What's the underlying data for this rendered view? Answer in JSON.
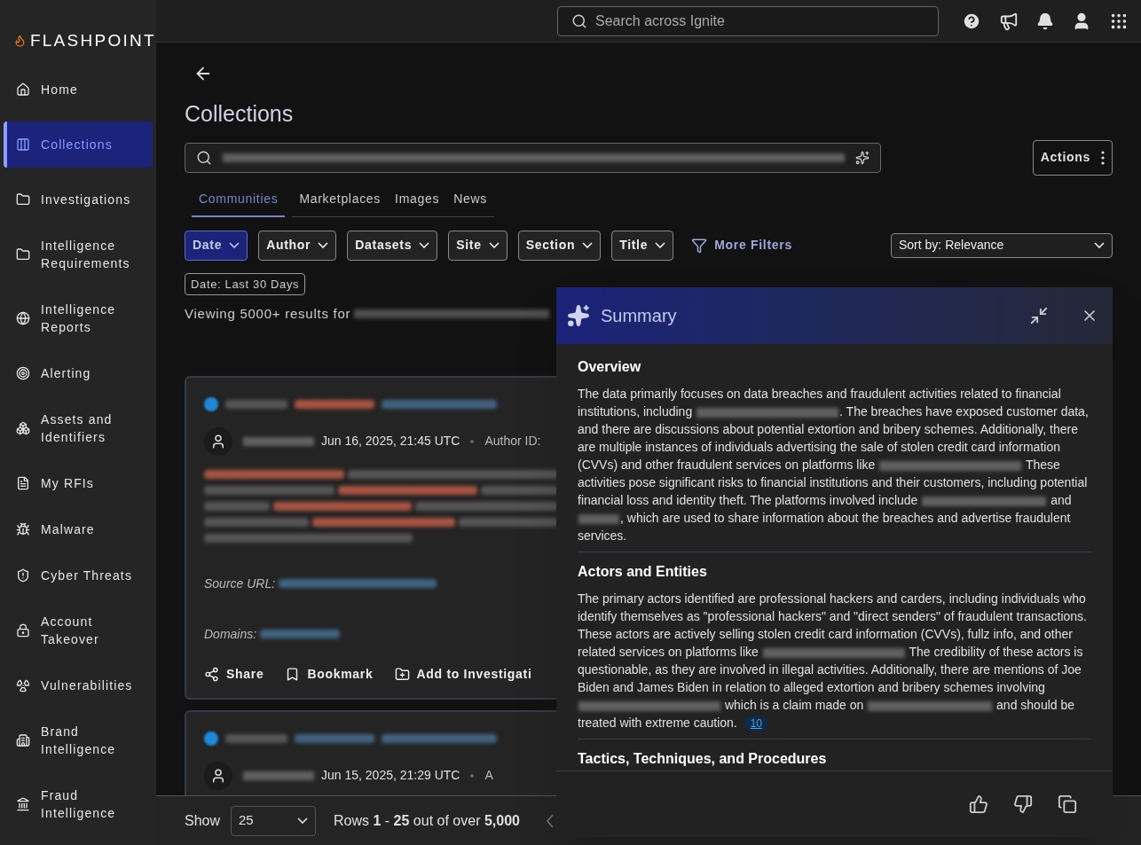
{
  "brand": {
    "name": "FLASHPOINT"
  },
  "sidebar": {
    "items": [
      {
        "label": "Home",
        "selected": false
      },
      {
        "label": "Collections",
        "selected": true
      },
      {
        "label": "Investigations",
        "selected": false
      },
      {
        "label": "Intelligence Requirements",
        "selected": false
      },
      {
        "label": "Intelligence Reports",
        "selected": false
      },
      {
        "label": "Alerting",
        "selected": false
      },
      {
        "label": "Assets and Identifiers",
        "selected": false
      },
      {
        "label": "My RFIs",
        "selected": false
      },
      {
        "label": "Malware",
        "selected": false
      },
      {
        "label": "Cyber Threats",
        "selected": false
      },
      {
        "label": "Account Takeover",
        "selected": false
      },
      {
        "label": "Vulnerabilities",
        "selected": false
      },
      {
        "label": "Brand Intelligence",
        "selected": false
      },
      {
        "label": "Fraud Intelligence",
        "selected": false
      }
    ]
  },
  "top_bar": {
    "search": {
      "placeholder": "Search across Ignite"
    }
  },
  "page": {
    "title": "Collections",
    "actions_button": "Actions",
    "tabs": [
      {
        "label": "Communities",
        "selected": true
      },
      {
        "label": "Marketplaces",
        "selected": false
      },
      {
        "label": "Images",
        "selected": false
      },
      {
        "label": "News",
        "selected": false
      }
    ],
    "filters": [
      {
        "label": "Date",
        "selected": true
      },
      {
        "label": "Author",
        "selected": false
      },
      {
        "label": "Datasets",
        "selected": false
      },
      {
        "label": "Site",
        "selected": false
      },
      {
        "label": "Section",
        "selected": false
      },
      {
        "label": "Title",
        "selected": false
      }
    ],
    "more_filters": "More Filters",
    "sort": {
      "value": "Sort by: Relevance"
    },
    "active_chip": "Date: Last 30 Days",
    "results_text": "Viewing 5000+ results for"
  },
  "results": [
    {
      "date": "Jun 16, 2025, 21:45 UTC",
      "author_id_label": "Author ID:",
      "source_url_label": "Source URL:",
      "domains_label": "Domains:",
      "actions": [
        {
          "kind": "share",
          "label": "Share"
        },
        {
          "kind": "bookmark",
          "label": "Bookmark"
        },
        {
          "kind": "investigation",
          "label": "Add to Investigati"
        }
      ]
    },
    {
      "date": "Jun 15, 2025, 21:29 UTC",
      "author_id_label": "A"
    }
  ],
  "pagination": {
    "show_label": "Show",
    "page_size": "25",
    "rows_text": "Rows **1** - **25** out of over **5,000**"
  },
  "summary": {
    "title": "Summary",
    "sections": [
      {
        "heading": "Overview",
        "paragraph": [
          {
            "kind": "text",
            "text": "The data primarily focuses on data breaches and fraudulent activities related to financial institutions, including "
          },
          {
            "kind": "redacted"
          },
          {
            "kind": "text",
            "text": ". The breaches have exposed customer data, and there are discussions about potential extortion and bribery schemes. Additionally, there are multiple instances of individuals advertising the sale of stolen credit card information (CVVs) and other fraudulent services on platforms like "
          },
          {
            "kind": "redacted"
          },
          {
            "kind": "text",
            "text": " These activities pose significant risks to financial institutions and their customers, including potential financial loss and identity theft. The platforms involved include "
          },
          {
            "kind": "redacted"
          },
          {
            "kind": "text",
            "text": " and "
          },
          {
            "kind": "redacted"
          },
          {
            "kind": "text",
            "text": ", which are used to share information about the breaches and advertise fraudulent services."
          }
        ]
      },
      {
        "heading": "Actors and Entities",
        "paragraph": [
          {
            "kind": "text",
            "text": "The primary actors identified are professional hackers and carders, including individuals who identify themselves as \"professional hackers\" and \"direct senders\" of fraudulent transactions. These actors are actively selling stolen credit card information (CVVs), fullz info, and other related services on platforms like "
          },
          {
            "kind": "redacted"
          },
          {
            "kind": "text",
            "text": " The credibility of these actors is questionable, as they are involved in illegal activities. Additionally, there are mentions of Joe Biden and James Biden in relation to alleged extortion and bribery schemes involving "
          },
          {
            "kind": "redacted"
          },
          {
            "kind": "text",
            "text": " which is a claim made on "
          },
          {
            "kind": "redacted"
          },
          {
            "kind": "text",
            "text": " and should be treated with extreme caution. "
          },
          {
            "kind": "citation",
            "text": "10"
          }
        ]
      },
      {
        "heading": "Tactics, Techniques, and Procedures"
      }
    ]
  }
}
